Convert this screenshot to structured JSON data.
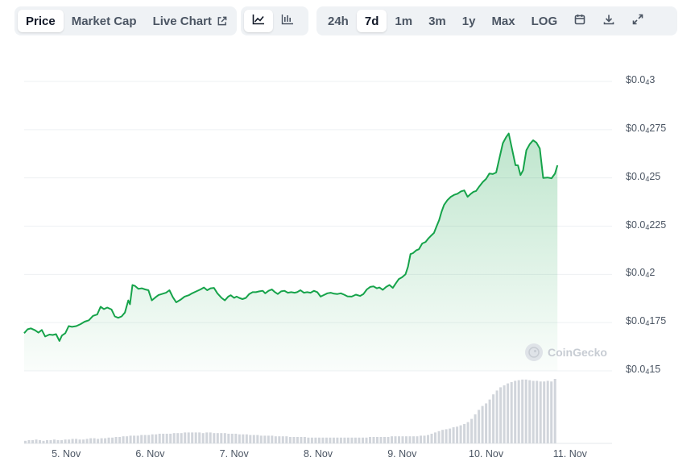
{
  "toolbar": {
    "view_tabs": [
      {
        "label": "Price",
        "active": true
      },
      {
        "label": "Market Cap",
        "active": false
      },
      {
        "label": "Live Chart",
        "active": false
      }
    ],
    "chart_type_icons": [
      "line-chart-icon",
      "candlestick-chart-icon"
    ],
    "ranges": [
      {
        "label": "24h",
        "active": false
      },
      {
        "label": "7d",
        "active": true
      },
      {
        "label": "1m",
        "active": false
      },
      {
        "label": "3m",
        "active": false
      },
      {
        "label": "1y",
        "active": false
      },
      {
        "label": "Max",
        "active": false
      },
      {
        "label": "LOG",
        "active": false
      }
    ],
    "tool_icons": [
      "calendar-icon",
      "download-icon",
      "fullscreen-icon"
    ]
  },
  "watermark": "CoinGecko",
  "colors": {
    "line": "#16a34a",
    "fill": "#16a34a",
    "volume": "#d1d5db",
    "grid": "#eef0f3"
  },
  "chart_data": {
    "type": "area",
    "y_ticks": [
      {
        "prefix": "$0.0",
        "sub": "4",
        "suffix": "3"
      },
      {
        "prefix": "$0.0",
        "sub": "4",
        "suffix": "275"
      },
      {
        "prefix": "$0.0",
        "sub": "4",
        "suffix": "25"
      },
      {
        "prefix": "$0.0",
        "sub": "4",
        "suffix": "225"
      },
      {
        "prefix": "$0.0",
        "sub": "4",
        "suffix": "2"
      },
      {
        "prefix": "$0.0",
        "sub": "4",
        "suffix": "175"
      },
      {
        "prefix": "$0.0",
        "sub": "4",
        "suffix": "15"
      }
    ],
    "ylim": [
      1.5e-05,
      3e-05
    ],
    "x_ticks": [
      "5. Nov",
      "6. Nov",
      "7. Nov",
      "8. Nov",
      "9. Nov",
      "10. Nov",
      "11. Nov"
    ],
    "x_start_day": 4.5,
    "x_end_day": 11.5,
    "price": [
      [
        4.5,
        1.695e-05
      ],
      [
        4.54,
        1.715e-05
      ],
      [
        4.58,
        1.72e-05
      ],
      [
        4.63,
        1.71e-05
      ],
      [
        4.67,
        1.698e-05
      ],
      [
        4.71,
        1.712e-05
      ],
      [
        4.75,
        1.678e-05
      ],
      [
        4.8,
        1.688e-05
      ],
      [
        4.84,
        1.686e-05
      ],
      [
        4.88,
        1.69e-05
      ],
      [
        4.92,
        1.655e-05
      ],
      [
        4.95,
        1.683e-05
      ],
      [
        4.99,
        1.695e-05
      ],
      [
        5.03,
        1.732e-05
      ],
      [
        5.07,
        1.728e-05
      ],
      [
        5.12,
        1.732e-05
      ],
      [
        5.17,
        1.742e-05
      ],
      [
        5.22,
        1.755e-05
      ],
      [
        5.27,
        1.762e-05
      ],
      [
        5.32,
        1.785e-05
      ],
      [
        5.37,
        1.792e-05
      ],
      [
        5.41,
        1.832e-05
      ],
      [
        5.45,
        1.82e-05
      ],
      [
        5.49,
        1.828e-05
      ],
      [
        5.54,
        1.818e-05
      ],
      [
        5.58,
        1.782e-05
      ],
      [
        5.62,
        1.775e-05
      ],
      [
        5.66,
        1.782e-05
      ],
      [
        5.7,
        1.802e-05
      ],
      [
        5.74,
        1.865e-05
      ],
      [
        5.76,
        1.845e-05
      ],
      [
        5.79,
        1.945e-05
      ],
      [
        5.82,
        1.94e-05
      ],
      [
        5.86,
        1.925e-05
      ],
      [
        5.9,
        1.928e-05
      ],
      [
        5.94,
        1.922e-05
      ],
      [
        5.98,
        1.918e-05
      ],
      [
        6.02,
        1.865e-05
      ],
      [
        6.06,
        1.88e-05
      ],
      [
        6.1,
        1.893e-05
      ],
      [
        6.14,
        1.898e-05
      ],
      [
        6.19,
        1.905e-05
      ],
      [
        6.23,
        1.918e-05
      ],
      [
        6.27,
        1.882e-05
      ],
      [
        6.31,
        1.855e-05
      ],
      [
        6.36,
        1.868e-05
      ],
      [
        6.41,
        1.885e-05
      ],
      [
        6.46,
        1.892e-05
      ],
      [
        6.5,
        1.902e-05
      ],
      [
        6.55,
        1.912e-05
      ],
      [
        6.6,
        1.922e-05
      ],
      [
        6.64,
        1.932e-05
      ],
      [
        6.68,
        1.918e-05
      ],
      [
        6.72,
        1.928e-05
      ],
      [
        6.76,
        1.93e-05
      ],
      [
        6.8,
        1.902e-05
      ],
      [
        6.85,
        1.878e-05
      ],
      [
        6.89,
        1.865e-05
      ],
      [
        6.93,
        1.885e-05
      ],
      [
        6.96,
        1.892e-05
      ],
      [
        7.0,
        1.878e-05
      ],
      [
        7.03,
        1.885e-05
      ],
      [
        7.06,
        1.878e-05
      ],
      [
        7.1,
        1.872e-05
      ],
      [
        7.14,
        1.878e-05
      ],
      [
        7.18,
        1.898e-05
      ],
      [
        7.22,
        1.908e-05
      ],
      [
        7.26,
        1.908e-05
      ],
      [
        7.3,
        1.912e-05
      ],
      [
        7.34,
        1.915e-05
      ],
      [
        7.37,
        1.902e-05
      ],
      [
        7.41,
        1.915e-05
      ],
      [
        7.45,
        1.922e-05
      ],
      [
        7.48,
        1.91e-05
      ],
      [
        7.52,
        1.898e-05
      ],
      [
        7.56,
        1.912e-05
      ],
      [
        7.6,
        1.915e-05
      ],
      [
        7.64,
        1.905e-05
      ],
      [
        7.68,
        1.908e-05
      ],
      [
        7.72,
        1.905e-05
      ],
      [
        7.75,
        1.908e-05
      ],
      [
        7.79,
        1.918e-05
      ],
      [
        7.83,
        1.905e-05
      ],
      [
        7.87,
        1.908e-05
      ],
      [
        7.91,
        1.905e-05
      ],
      [
        7.95,
        1.915e-05
      ],
      [
        7.99,
        1.908e-05
      ],
      [
        8.03,
        1.885e-05
      ],
      [
        8.07,
        1.893e-05
      ],
      [
        8.11,
        1.902e-05
      ],
      [
        8.15,
        1.905e-05
      ],
      [
        8.19,
        1.9e-05
      ],
      [
        8.23,
        1.898e-05
      ],
      [
        8.27,
        1.902e-05
      ],
      [
        8.31,
        1.895e-05
      ],
      [
        8.35,
        1.886e-05
      ],
      [
        8.4,
        1.885e-05
      ],
      [
        8.45,
        1.895e-05
      ],
      [
        8.5,
        1.888e-05
      ],
      [
        8.54,
        1.898e-05
      ],
      [
        8.58,
        1.922e-05
      ],
      [
        8.62,
        1.935e-05
      ],
      [
        8.66,
        1.938e-05
      ],
      [
        8.7,
        1.928e-05
      ],
      [
        8.73,
        1.932e-05
      ],
      [
        8.77,
        1.92e-05
      ],
      [
        8.81,
        1.935e-05
      ],
      [
        8.85,
        1.945e-05
      ],
      [
        8.89,
        1.93e-05
      ],
      [
        8.92,
        1.95e-05
      ],
      [
        8.96,
        1.975e-05
      ],
      [
        9.0,
        1.985e-05
      ],
      [
        9.04,
        2e-05
      ],
      [
        9.07,
        2.04e-05
      ],
      [
        9.1,
        2.105e-05
      ],
      [
        9.13,
        2.11e-05
      ],
      [
        9.17,
        2.125e-05
      ],
      [
        9.2,
        2.13e-05
      ],
      [
        9.24,
        2.16e-05
      ],
      [
        9.28,
        2.168e-05
      ],
      [
        9.31,
        2.185e-05
      ],
      [
        9.34,
        2.198e-05
      ],
      [
        9.38,
        2.215e-05
      ],
      [
        9.41,
        2.248e-05
      ],
      [
        9.44,
        2.28e-05
      ],
      [
        9.47,
        2.325e-05
      ],
      [
        9.5,
        2.36e-05
      ],
      [
        9.54,
        2.385e-05
      ],
      [
        9.58,
        2.402e-05
      ],
      [
        9.62,
        2.412e-05
      ],
      [
        9.66,
        2.418e-05
      ],
      [
        9.7,
        2.43e-05
      ],
      [
        9.74,
        2.435e-05
      ],
      [
        9.78,
        2.402e-05
      ],
      [
        9.82,
        2.418e-05
      ],
      [
        9.85,
        2.428e-05
      ],
      [
        9.88,
        2.432e-05
      ],
      [
        9.92,
        2.456e-05
      ],
      [
        9.96,
        2.478e-05
      ],
      [
        10.0,
        2.495e-05
      ],
      [
        10.04,
        2.523e-05
      ],
      [
        10.08,
        2.52e-05
      ],
      [
        10.12,
        2.528e-05
      ],
      [
        10.16,
        2.605e-05
      ],
      [
        10.2,
        2.68e-05
      ],
      [
        10.24,
        2.712e-05
      ],
      [
        10.27,
        2.73e-05
      ],
      [
        10.31,
        2.648e-05
      ],
      [
        10.35,
        2.566e-05
      ],
      [
        10.38,
        2.565e-05
      ],
      [
        10.41,
        2.515e-05
      ],
      [
        10.44,
        2.539e-05
      ],
      [
        10.48,
        2.643e-05
      ],
      [
        10.52,
        2.675e-05
      ],
      [
        10.56,
        2.695e-05
      ],
      [
        10.6,
        2.683e-05
      ],
      [
        10.64,
        2.652e-05
      ],
      [
        10.68,
        2.5e-05
      ],
      [
        10.73,
        2.502e-05
      ],
      [
        10.78,
        2.498e-05
      ],
      [
        10.82,
        2.522e-05
      ],
      [
        10.85,
        2.565e-05
      ]
    ],
    "volume": [
      0.04,
      0.05,
      0.05,
      0.06,
      0.05,
      0.04,
      0.05,
      0.05,
      0.06,
      0.05,
      0.05,
      0.06,
      0.06,
      0.07,
      0.07,
      0.06,
      0.06,
      0.07,
      0.08,
      0.08,
      0.07,
      0.08,
      0.08,
      0.09,
      0.09,
      0.1,
      0.1,
      0.11,
      0.11,
      0.12,
      0.12,
      0.12,
      0.13,
      0.13,
      0.13,
      0.14,
      0.14,
      0.15,
      0.15,
      0.15,
      0.15,
      0.16,
      0.16,
      0.16,
      0.17,
      0.17,
      0.17,
      0.17,
      0.17,
      0.16,
      0.17,
      0.17,
      0.16,
      0.16,
      0.16,
      0.16,
      0.15,
      0.15,
      0.15,
      0.14,
      0.14,
      0.14,
      0.13,
      0.13,
      0.13,
      0.12,
      0.12,
      0.12,
      0.12,
      0.11,
      0.11,
      0.11,
      0.11,
      0.1,
      0.1,
      0.1,
      0.1,
      0.1,
      0.09,
      0.09,
      0.09,
      0.09,
      0.09,
      0.09,
      0.09,
      0.09,
      0.09,
      0.09,
      0.09,
      0.09,
      0.09,
      0.09,
      0.09,
      0.09,
      0.09,
      0.1,
      0.1,
      0.1,
      0.1,
      0.1,
      0.1,
      0.11,
      0.11,
      0.11,
      0.11,
      0.11,
      0.11,
      0.11,
      0.11,
      0.12,
      0.12,
      0.13,
      0.15,
      0.17,
      0.19,
      0.21,
      0.22,
      0.23,
      0.25,
      0.26,
      0.28,
      0.3,
      0.33,
      0.38,
      0.45,
      0.52,
      0.58,
      0.62,
      0.68,
      0.76,
      0.82,
      0.87,
      0.9,
      0.93,
      0.95,
      0.97,
      0.98,
      0.99,
      0.99,
      0.98,
      0.97,
      0.97,
      0.96,
      0.96,
      0.97,
      0.96,
      1.0
    ]
  }
}
